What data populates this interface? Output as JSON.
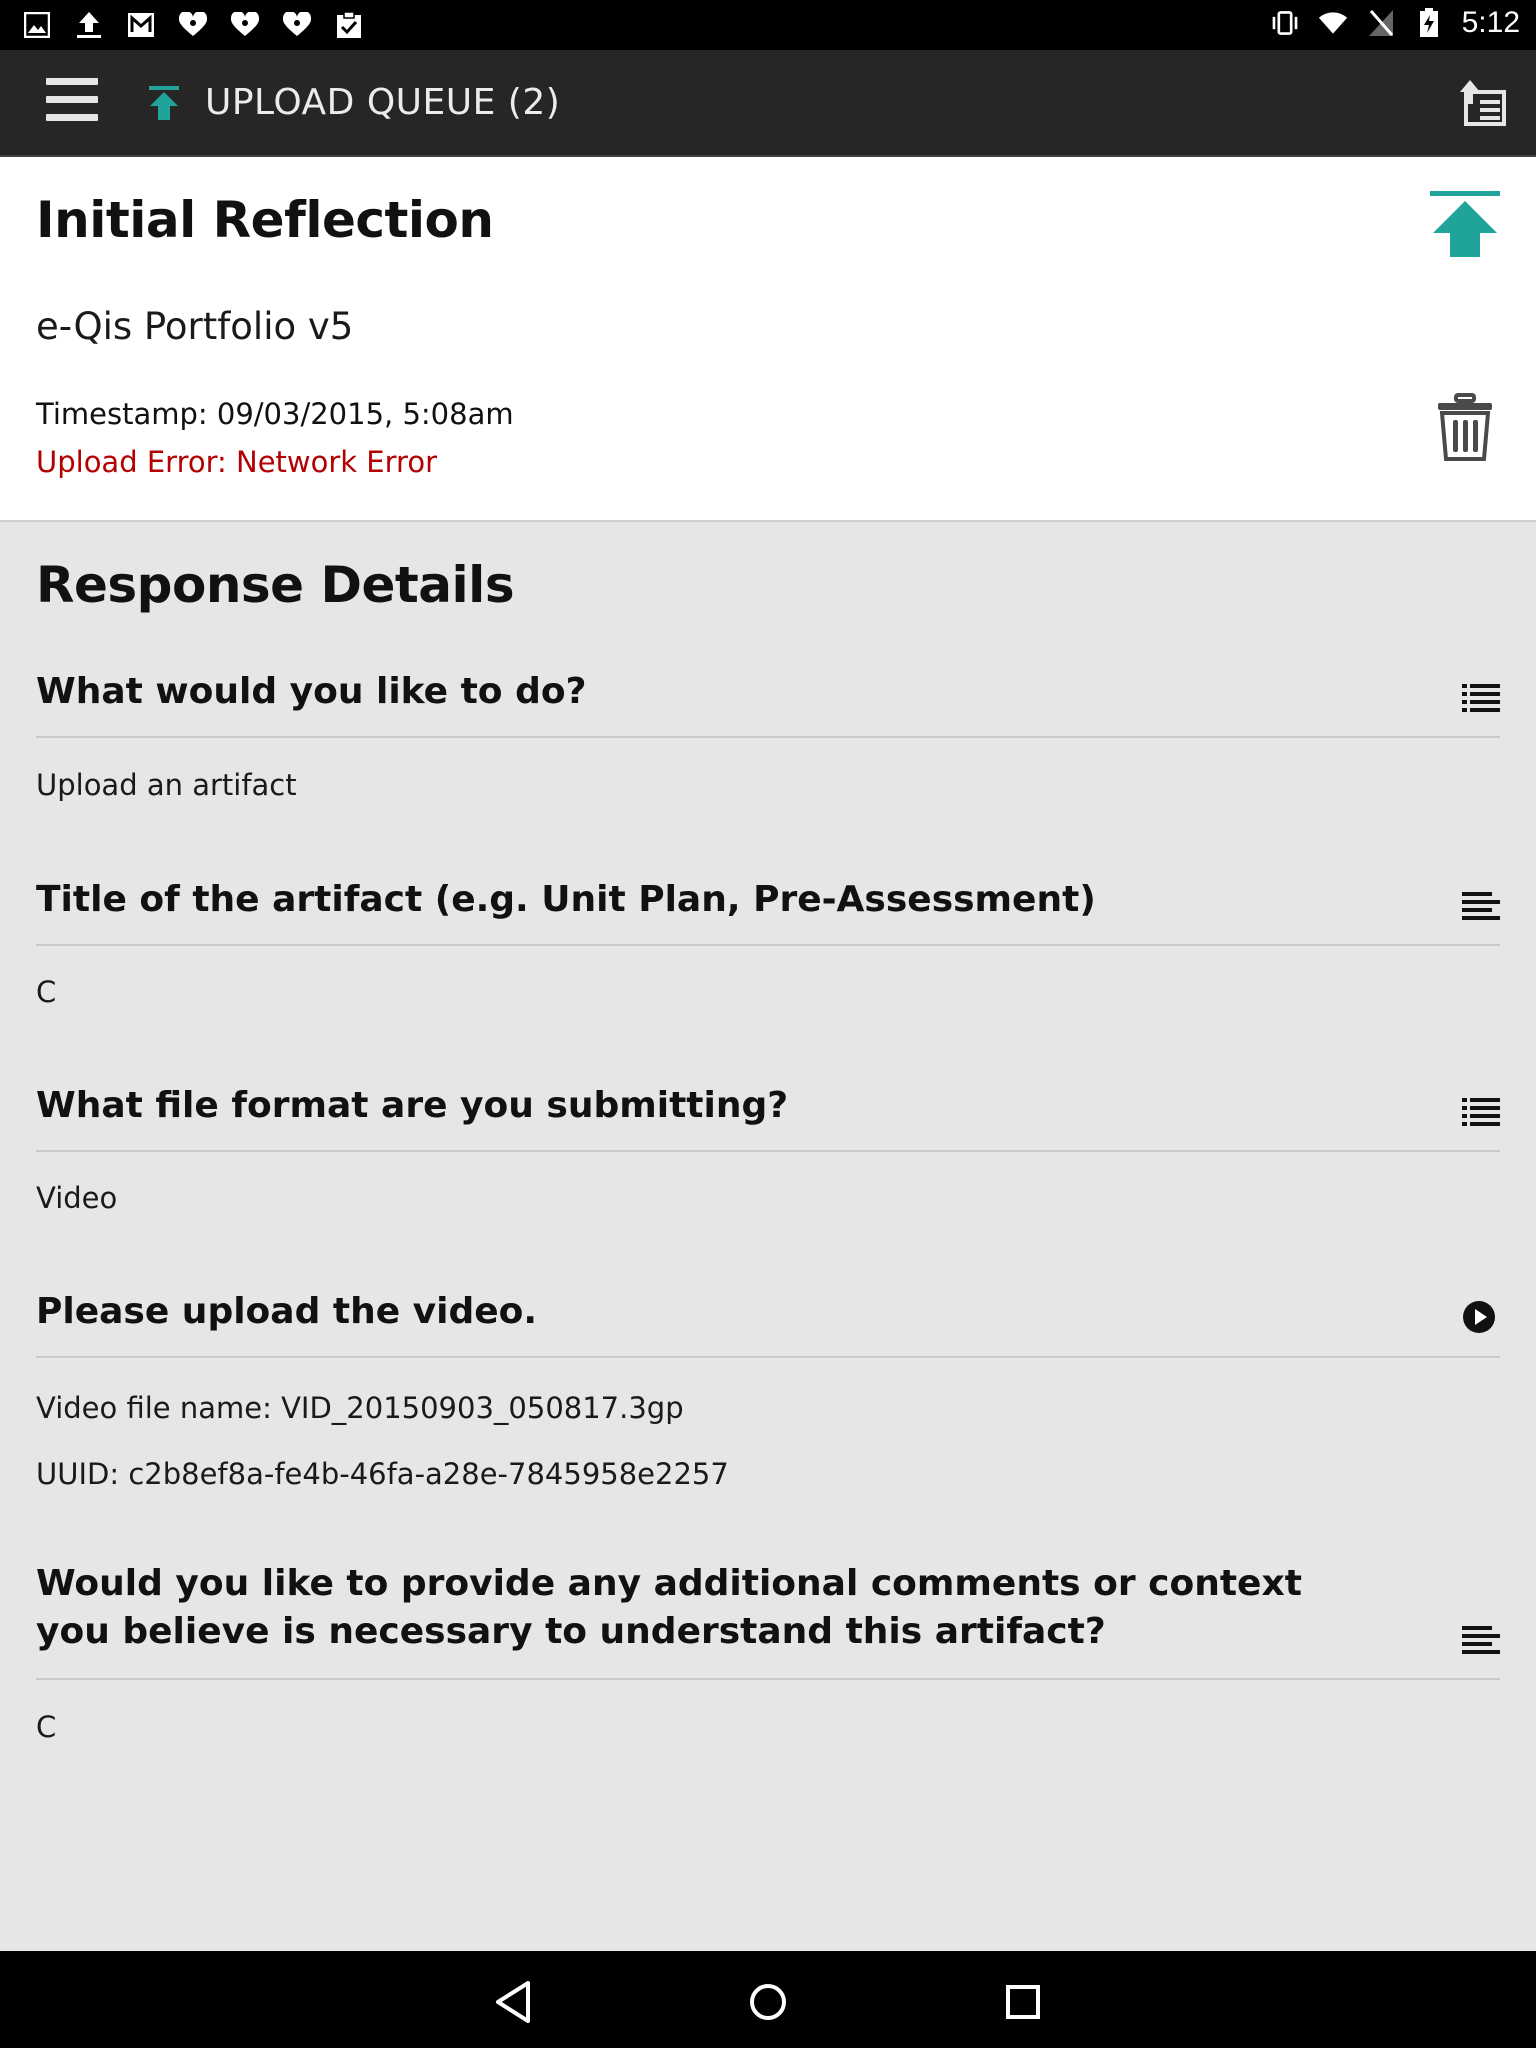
{
  "status_bar": {
    "time": "5:12",
    "left_icons": [
      "image-icon",
      "upload-icon",
      "gmail-icon",
      "iheart-icon",
      "iheart-icon",
      "iheart-icon",
      "clipboard-check-icon"
    ],
    "right_icons": [
      "vibrate-icon",
      "wifi-icon",
      "no-sim-icon",
      "battery-charging-icon"
    ]
  },
  "app_bar": {
    "title": "UPLOAD QUEUE (2)",
    "accent_color": "#1fa39a"
  },
  "header": {
    "title": "Initial Reflection",
    "subtitle": "e-Qis Portfolio v5",
    "timestamp": "Timestamp: 09/03/2015, 5:08am",
    "error": "Upload Error: Network Error",
    "error_color": "#b30000"
  },
  "details": {
    "title": "Response Details",
    "items": [
      {
        "question": "What would you like to do?",
        "answer": "Upload an artifact",
        "icon": "list-icon"
      },
      {
        "question": "Title of the artifact (e.g. Unit Plan, Pre-Assessment)",
        "answer": "C",
        "icon": "text-lines-icon"
      },
      {
        "question": "What file format are you submitting?",
        "answer": "Video",
        "icon": "list-icon"
      },
      {
        "question": "Please upload the video.",
        "answers": [
          "Video file name: VID_20150903_050817.3gp",
          "UUID: c2b8ef8a-fe4b-46fa-a28e-7845958e2257"
        ],
        "icon": "play-icon"
      },
      {
        "question": "Would you like to provide any additional comments or context you believe is necessary to understand this artifact?",
        "answer": "C",
        "icon": "text-lines-icon"
      }
    ]
  },
  "nav_bar": {
    "buttons": [
      "back-icon",
      "home-icon",
      "recents-icon"
    ]
  }
}
